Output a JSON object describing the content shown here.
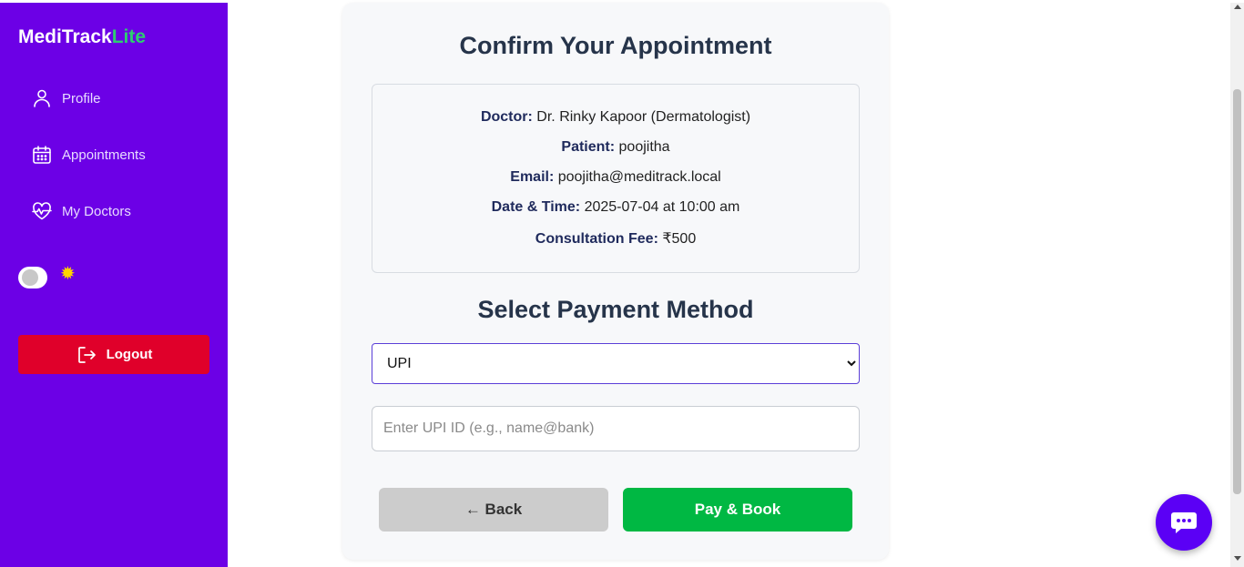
{
  "brand": {
    "name": "MediTrack",
    "suffix": "Lite",
    "accent": "#2ecc71"
  },
  "sidebar": {
    "background": "#6c00e6",
    "items": [
      {
        "label": "Profile",
        "icon": "user-icon"
      },
      {
        "label": "Appointments",
        "icon": "calendar-icon"
      },
      {
        "label": "My Doctors",
        "icon": "heart-pulse-icon"
      }
    ],
    "theme_toggle": {
      "state": "off",
      "icon": "sun-icon"
    },
    "logout_label": "Logout",
    "logout_color": "#e0002a"
  },
  "confirm": {
    "title": "Confirm Your Appointment",
    "details": [
      {
        "label": "Doctor:",
        "value": "Dr. Rinky Kapoor (Dermatologist)"
      },
      {
        "label": "Patient:",
        "value": "poojitha"
      },
      {
        "label": "Email:",
        "value": "poojitha@meditrack.local"
      },
      {
        "label": "Date & Time:",
        "value": "2025-07-04 at 10:00 am"
      },
      {
        "label": "Consultation Fee:",
        "value": "₹500"
      }
    ]
  },
  "payment": {
    "heading": "Select Payment Method",
    "selected": "UPI",
    "upi_placeholder": "Enter UPI ID (e.g., name@bank)",
    "upi_value": ""
  },
  "buttons": {
    "back_label": "← Back",
    "pay_label": "Pay & Book",
    "pay_color": "#00b843"
  },
  "chat": {
    "icon": "chat-bubble-icon",
    "color": "#5b00f5"
  }
}
